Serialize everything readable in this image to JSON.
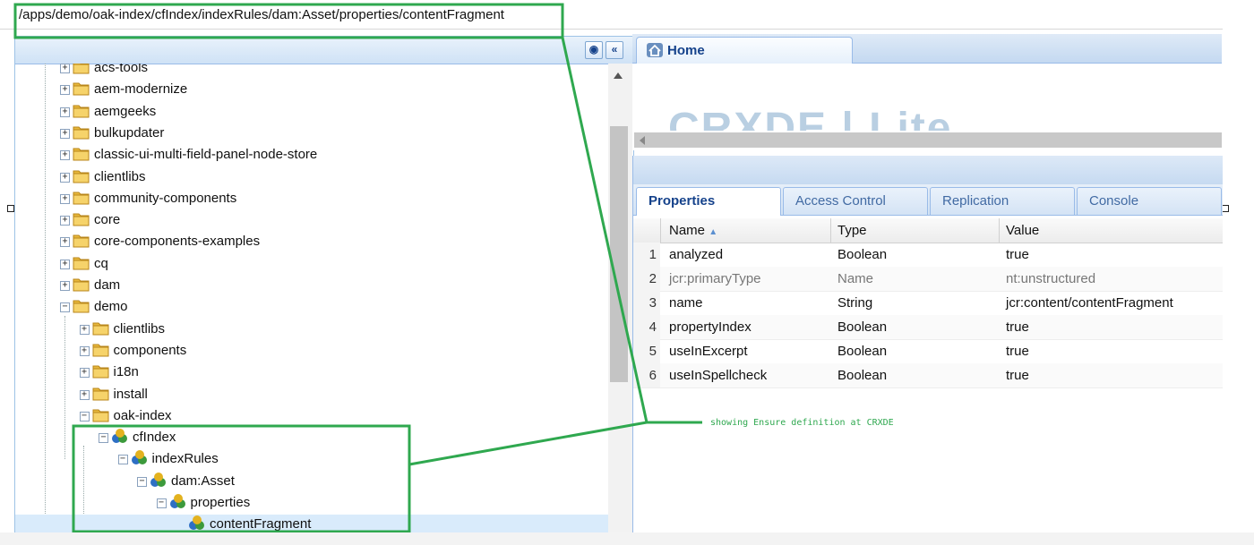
{
  "path_bar": {
    "path": "/apps/demo/oak-index/cfIndex/indexRules/dam:Asset/properties/contentFragment"
  },
  "tree": {
    "nodes": [
      {
        "label": "acs-tools",
        "type": "folder",
        "state": "collapsed"
      },
      {
        "label": "aem-modernize",
        "type": "folder",
        "state": "collapsed"
      },
      {
        "label": "aemgeeks",
        "type": "folder",
        "state": "collapsed"
      },
      {
        "label": "bulkupdater",
        "type": "folder",
        "state": "collapsed"
      },
      {
        "label": "classic-ui-multi-field-panel-node-store",
        "type": "folder",
        "state": "collapsed"
      },
      {
        "label": "clientlibs",
        "type": "folder",
        "state": "collapsed"
      },
      {
        "label": "community-components",
        "type": "folder",
        "state": "collapsed"
      },
      {
        "label": "core",
        "type": "folder",
        "state": "collapsed"
      },
      {
        "label": "core-components-examples",
        "type": "folder",
        "state": "collapsed"
      },
      {
        "label": "cq",
        "type": "folder",
        "state": "collapsed"
      },
      {
        "label": "dam",
        "type": "folder",
        "state": "collapsed"
      },
      {
        "label": "demo",
        "type": "folder",
        "state": "expanded"
      },
      {
        "label": "clientlibs",
        "type": "folder",
        "state": "collapsed"
      },
      {
        "label": "components",
        "type": "folder",
        "state": "collapsed"
      },
      {
        "label": "i18n",
        "type": "folder",
        "state": "collapsed"
      },
      {
        "label": "install",
        "type": "folder",
        "state": "collapsed"
      },
      {
        "label": "oak-index",
        "type": "folder",
        "state": "expanded"
      },
      {
        "label": "cfIndex",
        "type": "node",
        "state": "expanded"
      },
      {
        "label": "indexRules",
        "type": "node",
        "state": "expanded"
      },
      {
        "label": "dam:Asset",
        "type": "node",
        "state": "expanded"
      },
      {
        "label": "properties",
        "type": "node",
        "state": "expanded"
      },
      {
        "label": "contentFragment",
        "type": "node",
        "state": "leaf"
      }
    ]
  },
  "home_tab": {
    "label": "Home",
    "logo_text": "CRXDE | Lite"
  },
  "properties": {
    "tabs": [
      "Properties",
      "Access Control",
      "Replication",
      "Console"
    ],
    "active_tab": "Properties",
    "columns": {
      "name": "Name",
      "type": "Type",
      "value": "Value"
    },
    "rows": [
      {
        "num": "1",
        "name": "analyzed",
        "type": "Boolean",
        "value": "true"
      },
      {
        "num": "2",
        "name": "jcr:primaryType",
        "type": "Name",
        "value": "nt:unstructured"
      },
      {
        "num": "3",
        "name": "name",
        "type": "String",
        "value": "jcr:content/contentFragment"
      },
      {
        "num": "4",
        "name": "propertyIndex",
        "type": "Boolean",
        "value": "true"
      },
      {
        "num": "5",
        "name": "useInExcerpt",
        "type": "Boolean",
        "value": "true"
      },
      {
        "num": "6",
        "name": "useInSpellcheck",
        "type": "Boolean",
        "value": "true"
      }
    ]
  },
  "annotation": {
    "text": "showing Ensure definition at CRXDE",
    "color": "#2fa84f"
  },
  "colors": {
    "highlight_box": "#2fa84f",
    "selection": "#d9ebfb",
    "panel_border": "#99bbe8"
  }
}
